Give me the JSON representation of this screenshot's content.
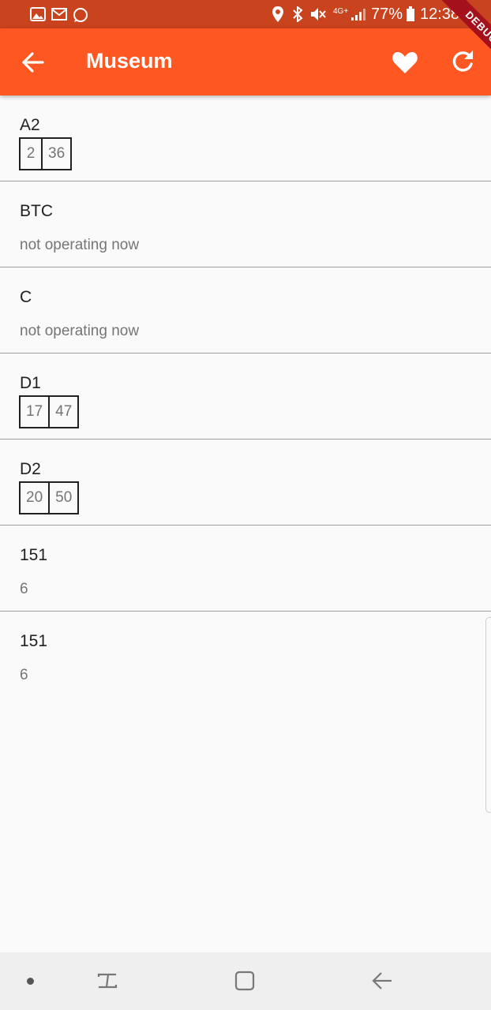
{
  "status_bar": {
    "battery_percent": "77%",
    "time": "12:38",
    "network": "4G+",
    "icons": [
      "gallery-icon",
      "gmail-icon",
      "whatsapp-icon",
      "location-icon",
      "bluetooth-icon",
      "mute-icon",
      "network-icon",
      "signal-icon",
      "battery-icon"
    ]
  },
  "app_bar": {
    "title": "Museum",
    "back_icon": "arrow-back-icon",
    "favorite_icon": "heart-icon",
    "refresh_icon": "refresh-icon",
    "color": "#ff5722"
  },
  "debug_banner": "DEBUG",
  "routes": [
    {
      "name": "A2",
      "times": [
        "2",
        "36"
      ]
    },
    {
      "name": "BTC",
      "subtitle": "not operating now"
    },
    {
      "name": "C",
      "subtitle": "not operating now"
    },
    {
      "name": "D1",
      "times": [
        "17",
        "47"
      ]
    },
    {
      "name": "D2",
      "times": [
        "20",
        "50"
      ]
    },
    {
      "name": "151",
      "subtitle": "6"
    },
    {
      "name": "151",
      "subtitle": "6"
    }
  ],
  "nav_bar": {
    "icons": [
      "dot-icon",
      "recent-apps-icon",
      "home-icon",
      "back-icon"
    ]
  }
}
